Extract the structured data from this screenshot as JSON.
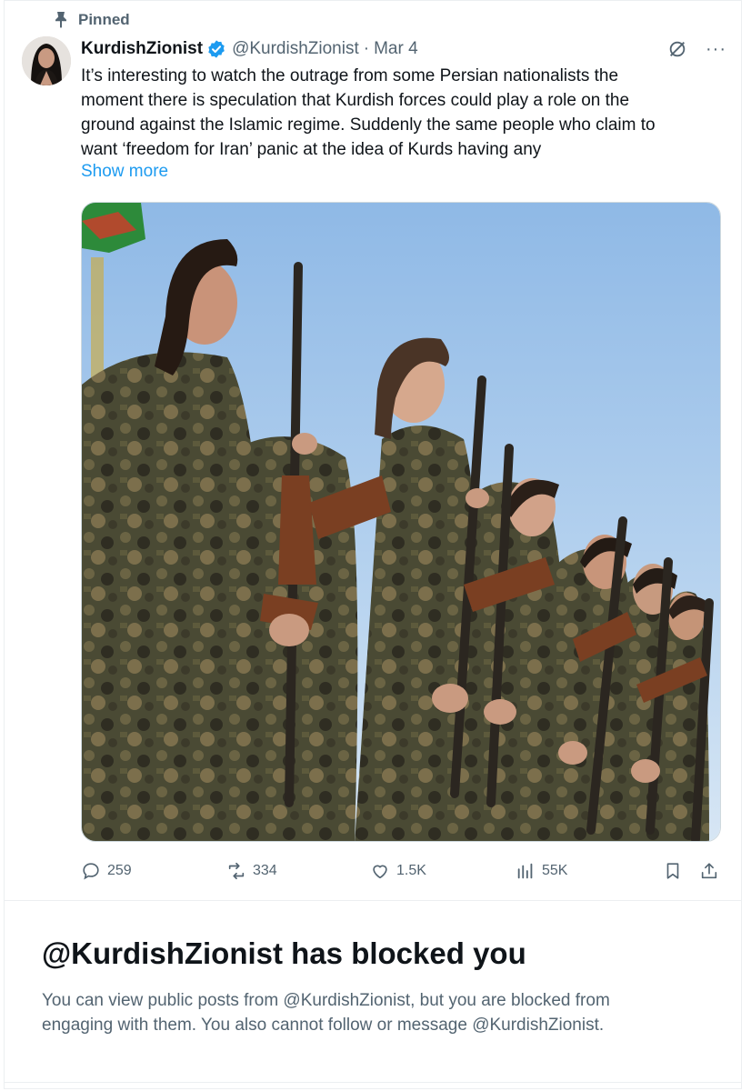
{
  "pinned": {
    "label": "Pinned",
    "icon": "pin-icon"
  },
  "tweet": {
    "author": {
      "display_name": "KurdishZionist",
      "handle": "@KurdishZionist",
      "verified": true,
      "avatar_icon": "avatar"
    },
    "separator": "·",
    "date": "Mar 4",
    "text_lines": [
      "It’s interesting to watch the outrage from some Persian nationalists the",
      "moment there is speculation that Kurdish forces could play a role on the",
      "ground against the Islamic regime. Suddenly the same people who claim to",
      "want ‘freedom for Iran’ panic at the idea of Kurds having any"
    ],
    "show_more_label": "Show more",
    "more_menu_label": "···",
    "media": {
      "type": "photo",
      "description_icon": "photo"
    },
    "actions": {
      "replies": "259",
      "reposts": "334",
      "likes": "1.5K",
      "views": "55K"
    }
  },
  "blocked_notice": {
    "title": "@KurdishZionist has blocked you",
    "description_lines": [
      "You can view public posts from @KurdishZionist, but you are blocked from",
      "engaging with them. You also cannot follow or message @KurdishZionist."
    ]
  },
  "colors": {
    "text_primary": "#0f1419",
    "text_secondary": "#536471",
    "link": "#1d9bf0",
    "verified": "#1d9bf0",
    "border": "#cfd9de"
  }
}
